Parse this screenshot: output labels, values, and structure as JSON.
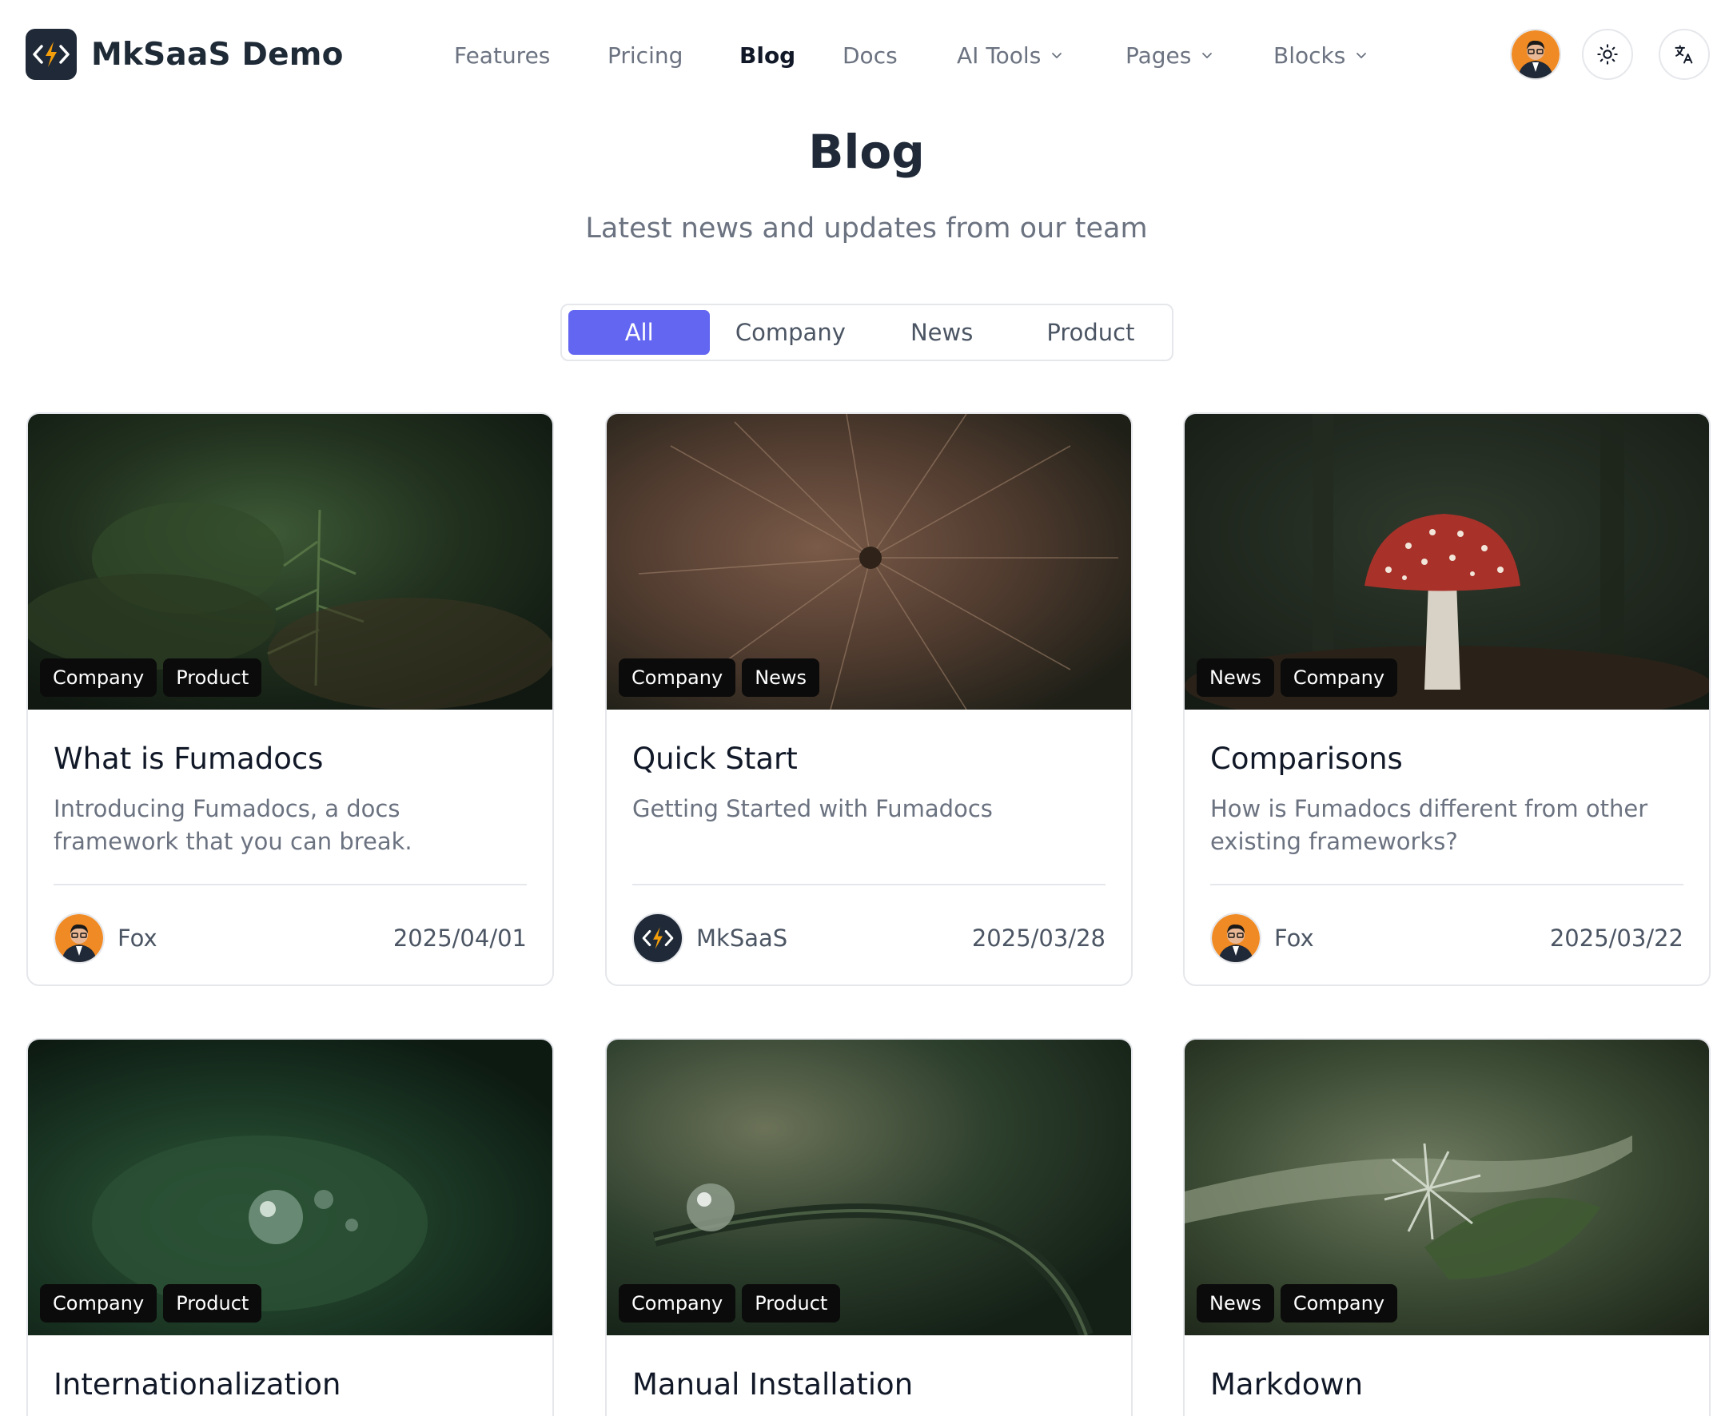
{
  "brand": {
    "name": "MkSaaS Demo",
    "logo_icon": "bolt-code-logo-icon"
  },
  "nav": {
    "items": [
      {
        "label": "Features",
        "dropdown": false,
        "active": false
      },
      {
        "label": "Pricing",
        "dropdown": false,
        "active": false
      },
      {
        "label": "Blog",
        "dropdown": false,
        "active": true
      },
      {
        "label": "Docs",
        "dropdown": false,
        "active": false
      },
      {
        "label": "AI Tools",
        "dropdown": true,
        "active": false
      },
      {
        "label": "Pages",
        "dropdown": true,
        "active": false
      },
      {
        "label": "Blocks",
        "dropdown": true,
        "active": false
      }
    ]
  },
  "header_actions": {
    "user_avatar_icon": "user-avatar",
    "theme_icon": "sun-icon",
    "language_icon": "translate-icon"
  },
  "page": {
    "title": "Blog",
    "subtitle": "Latest news and updates from our team"
  },
  "filter": {
    "tabs": [
      "All",
      "Company",
      "News",
      "Product"
    ],
    "active": "All"
  },
  "colors": {
    "accent": "#6366f1",
    "text_dark": "#111827",
    "text_muted": "#6b7280",
    "border": "#e5e7eb"
  },
  "posts": [
    {
      "title": "What is Fumadocs",
      "description": "Introducing Fumadocs, a docs framework that you can break.",
      "tags": [
        "Company",
        "Product"
      ],
      "author": "Fox",
      "date": "2025/04/01"
    },
    {
      "title": "Quick Start",
      "description": "Getting Started with Fumadocs",
      "tags": [
        "Company",
        "News"
      ],
      "author": "MkSaaS",
      "date": "2025/03/28"
    },
    {
      "title": "Comparisons",
      "description": "How is Fumadocs different from other existing frameworks?",
      "tags": [
        "News",
        "Company"
      ],
      "author": "Fox",
      "date": "2025/03/22"
    },
    {
      "title": "Internationalization",
      "tags": [
        "Company",
        "Product"
      ]
    },
    {
      "title": "Manual Installation",
      "tags": [
        "Company",
        "Product"
      ]
    },
    {
      "title": "Markdown",
      "tags": [
        "News",
        "Company"
      ]
    }
  ]
}
